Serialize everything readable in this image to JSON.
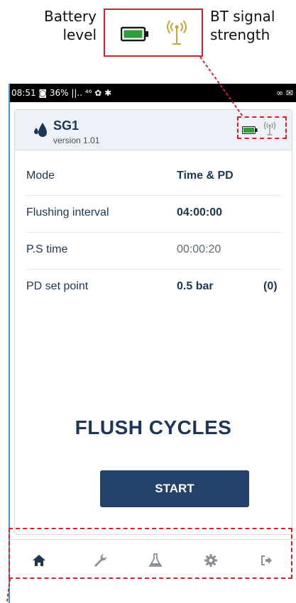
{
  "callouts": {
    "battery": "Battery level",
    "bt_signal": "BT signal strength"
  },
  "statusbar": {
    "left": "08:51 ◙ 36% ||.. ⁴⁶ ✿ ✱",
    "right": "∞ ✉"
  },
  "device": {
    "name": "SG1",
    "version": "version 1.01"
  },
  "rows": [
    {
      "label": "Mode",
      "value": "Time & PD",
      "extra": ""
    },
    {
      "label": "Flushing interval",
      "value": "04:00:00",
      "extra": ""
    },
    {
      "label": "P.S time",
      "value": "00:00:20",
      "extra": ""
    },
    {
      "label": "PD set point",
      "value": "0.5 bar",
      "extra": "(0)"
    }
  ],
  "main": {
    "title": "FLUSH CYCLES",
    "start_label": "START"
  },
  "nav": [
    "home-icon",
    "wrench-icon",
    "flask-icon",
    "gear-icon",
    "logout-icon"
  ],
  "colors": {
    "accent": "#22416b",
    "battery": "#2e9e3a",
    "antenna": "#c9a437",
    "annotation": "#d6222a"
  }
}
